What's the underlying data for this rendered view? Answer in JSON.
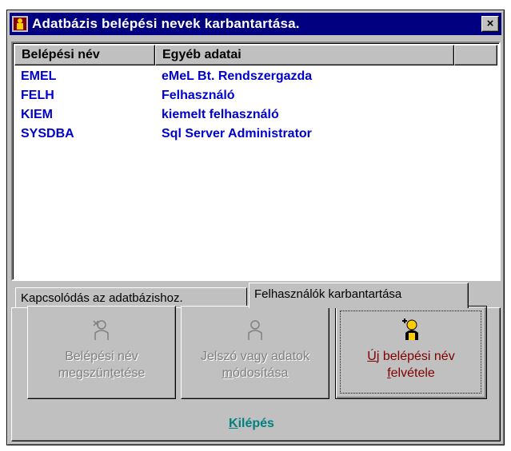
{
  "window": {
    "title": "Adatbázis belépési nevek karbantartása.",
    "close_label": "×"
  },
  "list": {
    "columns": [
      "Belépési név",
      "Egyéb adatai",
      ""
    ],
    "rows": [
      {
        "name": "EMEL",
        "info": "eMeL Bt. Rendszergazda"
      },
      {
        "name": "FELH",
        "info": "Felhasználó"
      },
      {
        "name": "KIEM",
        "info": "kiemelt felhasználó"
      },
      {
        "name": "SYSDBA",
        "info": "Sql Server Administrator"
      }
    ],
    "row_color": "#0000cc"
  },
  "tabs": [
    {
      "label": "Kapcsolódás az adatbázishoz.",
      "active": false
    },
    {
      "label": "Felhasználók karbantartása",
      "active": true
    }
  ],
  "buttons": {
    "delete": {
      "line1": "Belépési név",
      "line2_pre": "megszün",
      "line2_hot": "t",
      "line2_post": "etése",
      "icon": "user-delete-icon",
      "enabled": false
    },
    "modify": {
      "line1": "Jelszó vagy adatok",
      "line2_pre": "",
      "line2_hot": "m",
      "line2_post": "ódosítása",
      "icon": "user-edit-icon",
      "enabled": false
    },
    "new": {
      "line1_pre": "",
      "line1_hot": "Ú",
      "line1_post": "j belépési név",
      "line2_pre": "",
      "line2_hot": "f",
      "line2_post": "elvétele",
      "icon": "user-add-icon",
      "enabled": true
    }
  },
  "exit": {
    "hot": "K",
    "rest": "ilépés"
  },
  "colors": {
    "titlebar": "#000080",
    "face": "#c0c0c0",
    "exit": "#008080",
    "new_button_text": "#800000"
  }
}
